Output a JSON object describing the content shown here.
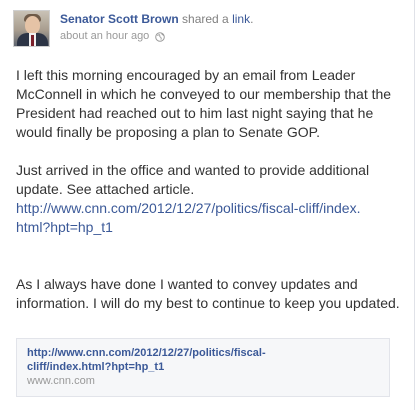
{
  "post": {
    "author": "Senator Scott Brown",
    "action": "shared a",
    "action_link": "link",
    "action_end": ".",
    "timestamp": "about an hour ago",
    "privacy_icon": "globe-icon",
    "paragraphs": [
      "I left this morning encouraged by an email from Leader McConnell in which he conveyed to our membership that the President had reached out to him last night saying that he would finally be proposing a plan to Senate GOP.",
      "Just arrived in the office and wanted to provide additional update. See attached article.",
      "As I always have done I wanted to convey updates and information. I will do my best to continue to keep you updated."
    ],
    "inline_link": "http://www.cnn.com/2012/12/27/politics/fiscal-cliff/index.html?hpt=hp_t1"
  },
  "attachment": {
    "title": "http://www.cnn.com/2012/12/27/politics/fiscal-cliff/index.html?hpt=hp_t1",
    "domain": "www.cnn.com"
  },
  "colors": {
    "link_blue": "#3b5998",
    "meta_gray": "#999999",
    "text": "#333333",
    "attachment_bg": "#f6f7f9"
  }
}
